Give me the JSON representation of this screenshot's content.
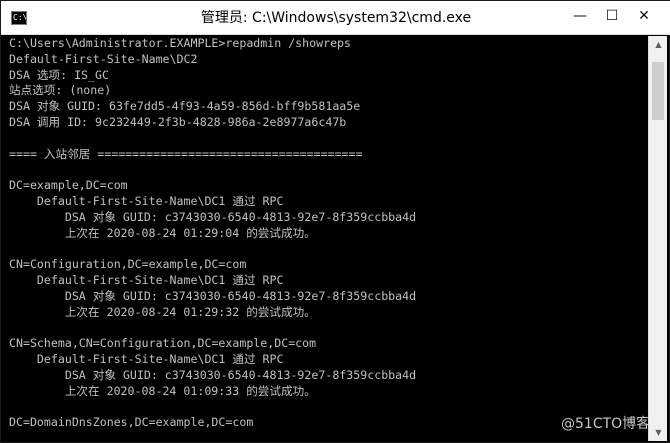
{
  "window": {
    "title": "管理员: C:\\Windows\\system32\\cmd.exe",
    "icon_text": "C:\\",
    "controls": {
      "minimize": "—",
      "maximize": "☐",
      "close": "✕"
    }
  },
  "console": {
    "lines": [
      "C:\\Users\\Administrator.EXAMPLE>repadmin /showreps",
      "Default-First-Site-Name\\DC2",
      "DSA 选项: IS_GC",
      "站点选项: (none)",
      "DSA 对象 GUID: 63fe7dd5-4f93-4a59-856d-bff9b581aa5e",
      "DSA 调用 ID: 9c232449-2f3b-4828-986a-2e8977a6c47b",
      "",
      "==== 入站邻居 ======================================",
      "",
      "DC=example,DC=com",
      "    Default-First-Site-Name\\DC1 通过 RPC",
      "        DSA 对象 GUID: c3743030-6540-4813-92e7-8f359ccbba4d",
      "        上次在 2020-08-24 01:29:04 的尝试成功。",
      "",
      "CN=Configuration,DC=example,DC=com",
      "    Default-First-Site-Name\\DC1 通过 RPC",
      "        DSA 对象 GUID: c3743030-6540-4813-92e7-8f359ccbba4d",
      "        上次在 2020-08-24 01:29:32 的尝试成功。",
      "",
      "CN=Schema,CN=Configuration,DC=example,DC=com",
      "    Default-First-Site-Name\\DC1 通过 RPC",
      "        DSA 对象 GUID: c3743030-6540-4813-92e7-8f359ccbba4d",
      "        上次在 2020-08-24 01:09:33 的尝试成功。",
      "",
      "DC=DomainDnsZones,DC=example,DC=com"
    ]
  },
  "scrollbar": {
    "up_arrow": "▲",
    "down_arrow": "▼"
  },
  "watermark": "@51CTO博客",
  "colors": {
    "console_bg": "#000000",
    "console_text": "#c0c0c0",
    "titlebar_bg": "#ffffff"
  }
}
